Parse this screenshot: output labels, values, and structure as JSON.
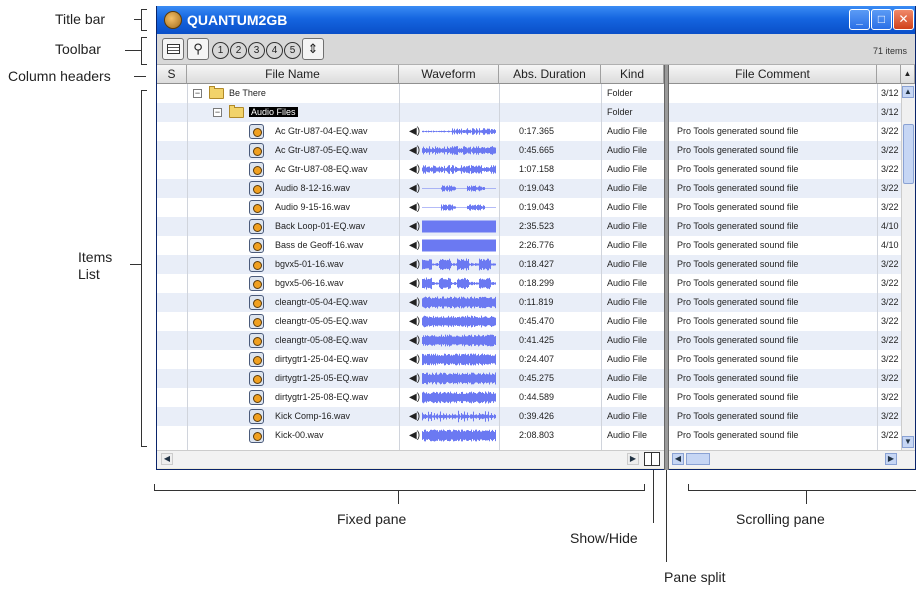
{
  "callouts": {
    "title_bar": "Title bar",
    "toolbar": "Toolbar",
    "column_headers": "Column headers",
    "items_list_1": "Items",
    "items_list_2": "List",
    "fixed_pane": "Fixed pane",
    "show_hide": "Show/Hide",
    "scrolling_pane": "Scrolling pane",
    "pane_split": "Pane split"
  },
  "window": {
    "title": "QUANTUM2GB",
    "minimize": "_",
    "maximize": "□",
    "close": "✕"
  },
  "toolbar": {
    "browser_icon": "browser-menu-icon",
    "find_icon": "magnifier-icon",
    "find_glyph": "⚲",
    "slots": [
      "1",
      "2",
      "3",
      "4",
      "5"
    ],
    "expand_glyph": "⇕",
    "item_count": "71 items"
  },
  "columns": {
    "s": "S",
    "file_name": "File Name",
    "waveform": "Waveform",
    "abs_duration": "Abs. Duration",
    "kind": "Kind",
    "file_comment": "File Comment"
  },
  "rows": [
    {
      "name": "Be There",
      "type": "folder",
      "level": 0,
      "duration": "",
      "kind": "Folder",
      "comment": "",
      "date": "3/12"
    },
    {
      "name": "Audio Files",
      "type": "folder",
      "level": 1,
      "selected": true,
      "duration": "",
      "kind": "Folder",
      "comment": "",
      "date": "3/12"
    },
    {
      "name": "Ac Gtr-U87-04-EQ.wav",
      "type": "file",
      "wave": "sparse",
      "duration": "0:17.365",
      "kind": "Audio File",
      "comment": "Pro Tools generated sound file",
      "date": "3/22"
    },
    {
      "name": "Ac Gtr-U87-05-EQ.wav",
      "type": "file",
      "wave": "medium",
      "duration": "0:45.665",
      "kind": "Audio File",
      "comment": "Pro Tools generated sound file",
      "date": "3/22"
    },
    {
      "name": "Ac Gtr-U87-08-EQ.wav",
      "type": "file",
      "wave": "medium",
      "duration": "1:07.158",
      "kind": "Audio File",
      "comment": "Pro Tools generated sound file",
      "date": "3/22"
    },
    {
      "name": "Audio 8-12-16.wav",
      "type": "file",
      "wave": "thin",
      "duration": "0:19.043",
      "kind": "Audio File",
      "comment": "Pro Tools generated sound file",
      "date": "3/22"
    },
    {
      "name": "Audio 9-15-16.wav",
      "type": "file",
      "wave": "thin",
      "duration": "0:19.043",
      "kind": "Audio File",
      "comment": "Pro Tools generated sound file",
      "date": "3/22"
    },
    {
      "name": "Back Loop-01-EQ.wav",
      "type": "file",
      "wave": "full",
      "duration": "2:35.523",
      "kind": "Audio File",
      "comment": "Pro Tools generated sound file",
      "date": "4/10"
    },
    {
      "name": "Bass de Geoff-16.wav",
      "type": "file",
      "wave": "full",
      "duration": "2:26.776",
      "kind": "Audio File",
      "comment": "Pro Tools generated sound file",
      "date": "4/10"
    },
    {
      "name": "bgvx5-01-16.wav",
      "type": "file",
      "wave": "bursts",
      "duration": "0:18.427",
      "kind": "Audio File",
      "comment": "Pro Tools generated sound file",
      "date": "3/22"
    },
    {
      "name": "bgvx5-06-16.wav",
      "type": "file",
      "wave": "bursts",
      "duration": "0:18.299",
      "kind": "Audio File",
      "comment": "Pro Tools generated sound file",
      "date": "3/22"
    },
    {
      "name": "cleangtr-05-04-EQ.wav",
      "type": "file",
      "wave": "dense",
      "duration": "0:11.819",
      "kind": "Audio File",
      "comment": "Pro Tools generated sound file",
      "date": "3/22"
    },
    {
      "name": "cleangtr-05-05-EQ.wav",
      "type": "file",
      "wave": "dense",
      "duration": "0:45.470",
      "kind": "Audio File",
      "comment": "Pro Tools generated sound file",
      "date": "3/22"
    },
    {
      "name": "cleangtr-05-08-EQ.wav",
      "type": "file",
      "wave": "dense",
      "duration": "0:41.425",
      "kind": "Audio File",
      "comment": "Pro Tools generated sound file",
      "date": "3/22"
    },
    {
      "name": "dirtygtr1-25-04-EQ.wav",
      "type": "file",
      "wave": "dense",
      "duration": "0:24.407",
      "kind": "Audio File",
      "comment": "Pro Tools generated sound file",
      "date": "3/22"
    },
    {
      "name": "dirtygtr1-25-05-EQ.wav",
      "type": "file",
      "wave": "dense",
      "duration": "0:45.275",
      "kind": "Audio File",
      "comment": "Pro Tools generated sound file",
      "date": "3/22"
    },
    {
      "name": "dirtygtr1-25-08-EQ.wav",
      "type": "file",
      "wave": "dense",
      "duration": "0:44.589",
      "kind": "Audio File",
      "comment": "Pro Tools generated sound file",
      "date": "3/22"
    },
    {
      "name": "Kick Comp-16.wav",
      "type": "file",
      "wave": "spiky",
      "duration": "0:39.426",
      "kind": "Audio File",
      "comment": "Pro Tools generated sound file",
      "date": "3/22"
    },
    {
      "name": "Kick-00.wav",
      "type": "file",
      "wave": "dense",
      "duration": "2:08.803",
      "kind": "Audio File",
      "comment": "Pro Tools generated sound file",
      "date": "3/22"
    }
  ],
  "colors": {
    "waveform": "#6b79f2",
    "title_bar": "#1565e0",
    "selection": "#000000"
  }
}
